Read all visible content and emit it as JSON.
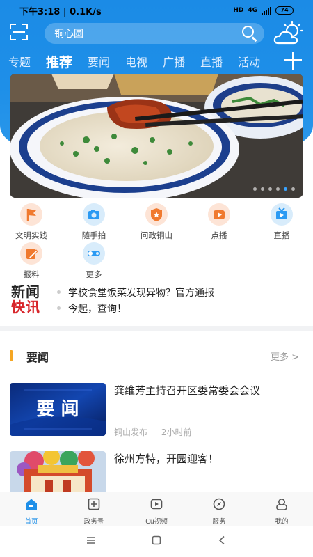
{
  "status_bar": {
    "time": "下午3:18 | 0.1K/s",
    "hd": "HD",
    "network": "4G",
    "battery": "74"
  },
  "top_bar": {
    "search_value": "铜心圆",
    "scan_icon": "scan-icon",
    "weather_icon": "partly-cloudy-icon"
  },
  "tabs": [
    {
      "label": "专题",
      "active": false
    },
    {
      "label": "推荐",
      "active": true
    },
    {
      "label": "要闻",
      "active": false
    },
    {
      "label": "电视",
      "active": false
    },
    {
      "label": "广播",
      "active": false
    },
    {
      "label": "直播",
      "active": false
    },
    {
      "label": "活动",
      "active": false
    }
  ],
  "banner": {
    "pages": 6,
    "active_page": 5
  },
  "quick_links": [
    {
      "label": "文明实践",
      "icon": "flag-icon",
      "color": "orange"
    },
    {
      "label": "随手拍",
      "icon": "camera-icon",
      "color": "blue"
    },
    {
      "label": "问政铜山",
      "icon": "shield-star-icon",
      "color": "orange"
    },
    {
      "label": "点播",
      "icon": "play-icon",
      "color": "orange"
    },
    {
      "label": "直播",
      "icon": "tv-icon",
      "color": "blue"
    },
    {
      "label": "报料",
      "icon": "edit-icon",
      "color": "orange"
    },
    {
      "label": "更多",
      "icon": "toggle-icon",
      "color": "blue"
    }
  ],
  "news_flash": {
    "logo_top": "新闻",
    "logo_bottom": "快讯",
    "items": [
      "学校食堂饭菜发现异物？官方通报",
      "今起，查询！"
    ]
  },
  "section": {
    "title": "要闻",
    "more": "更多 >"
  },
  "news": [
    {
      "thumb_text": "要 闻",
      "headline": "龚维芳主持召开区委常委会会议",
      "source": "铜山发布",
      "time": "2小时前"
    },
    {
      "headline": "徐州方特，开园迎客！"
    }
  ],
  "bottom_nav": [
    {
      "label": "首页",
      "icon": "home-icon",
      "active": true
    },
    {
      "label": "政务号",
      "icon": "plus-square-icon",
      "active": false
    },
    {
      "label": "Cu视频",
      "icon": "video-icon",
      "active": false
    },
    {
      "label": "服务",
      "icon": "compass-icon",
      "active": false
    },
    {
      "label": "我的",
      "icon": "user-icon",
      "active": false
    }
  ],
  "colors": {
    "brand_blue": "#1e8fe8",
    "accent_orange": "#f5a623",
    "flash_red": "#d8252a"
  }
}
